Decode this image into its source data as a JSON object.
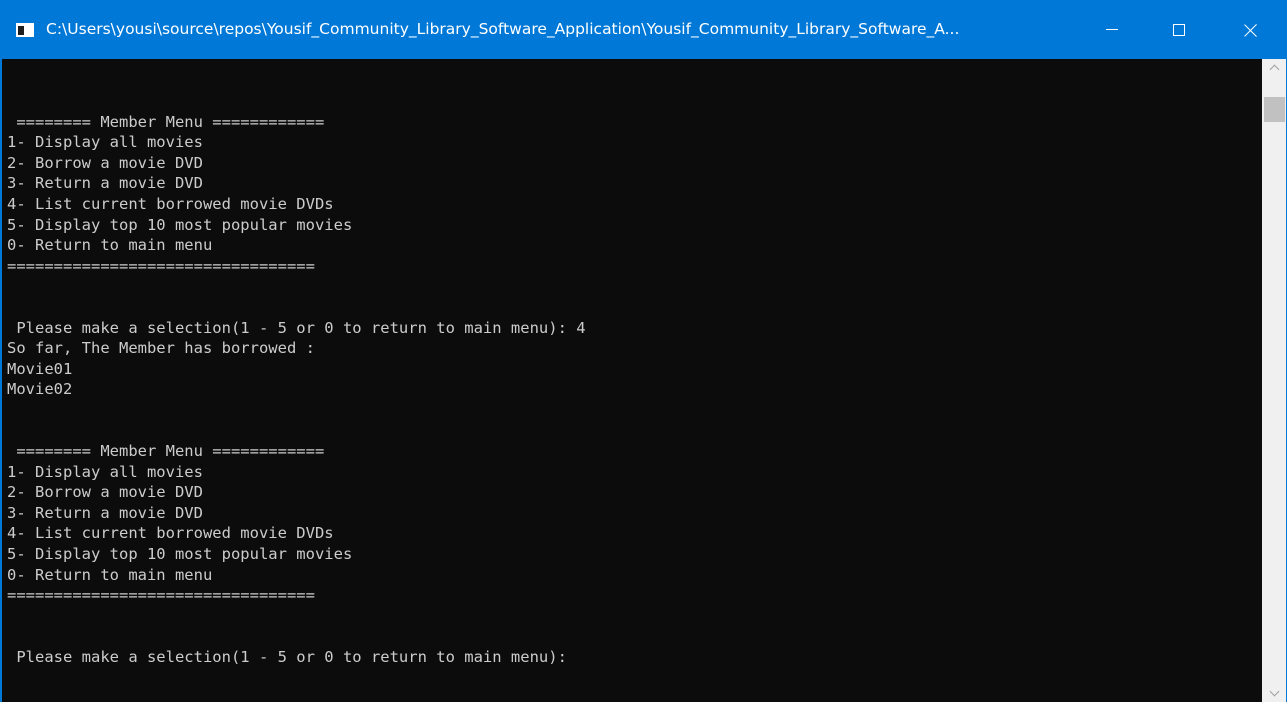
{
  "window": {
    "title": "C:\\Users\\yousi\\source\\repos\\Yousif_Community_Library_Software_Application\\Yousif_Community_Library_Software_A..."
  },
  "icons": {
    "app": "console-app-icon",
    "minimize": "minimize-icon",
    "maximize": "maximize-icon",
    "close": "close-icon",
    "scroll_up": "chevron-up-icon",
    "scroll_down": "chevron-down-icon"
  },
  "colors": {
    "titlebar": "#0078d7",
    "console_bg": "#0c0c0c",
    "console_text": "#cccccc"
  },
  "console": {
    "lines": [
      "",
      " ======== Member Menu ============",
      "1- Display all movies",
      "2- Borrow a movie DVD",
      "3- Return a movie DVD",
      "4- List current borrowed movie DVDs",
      "5- Display top 10 most popular movies",
      "0- Return to main menu",
      "=================================",
      "",
      "",
      " Please make a selection(1 - 5 or 0 to return to main menu): 4",
      "So far, The Member has borrowed :",
      "Movie01",
      "Movie02",
      "",
      "",
      " ======== Member Menu ============",
      "1- Display all movies",
      "2- Borrow a movie DVD",
      "3- Return a movie DVD",
      "4- List current borrowed movie DVDs",
      "5- Display top 10 most popular movies",
      "0- Return to main menu",
      "=================================",
      "",
      "",
      " Please make a selection(1 - 5 or 0 to return to main menu): "
    ]
  }
}
